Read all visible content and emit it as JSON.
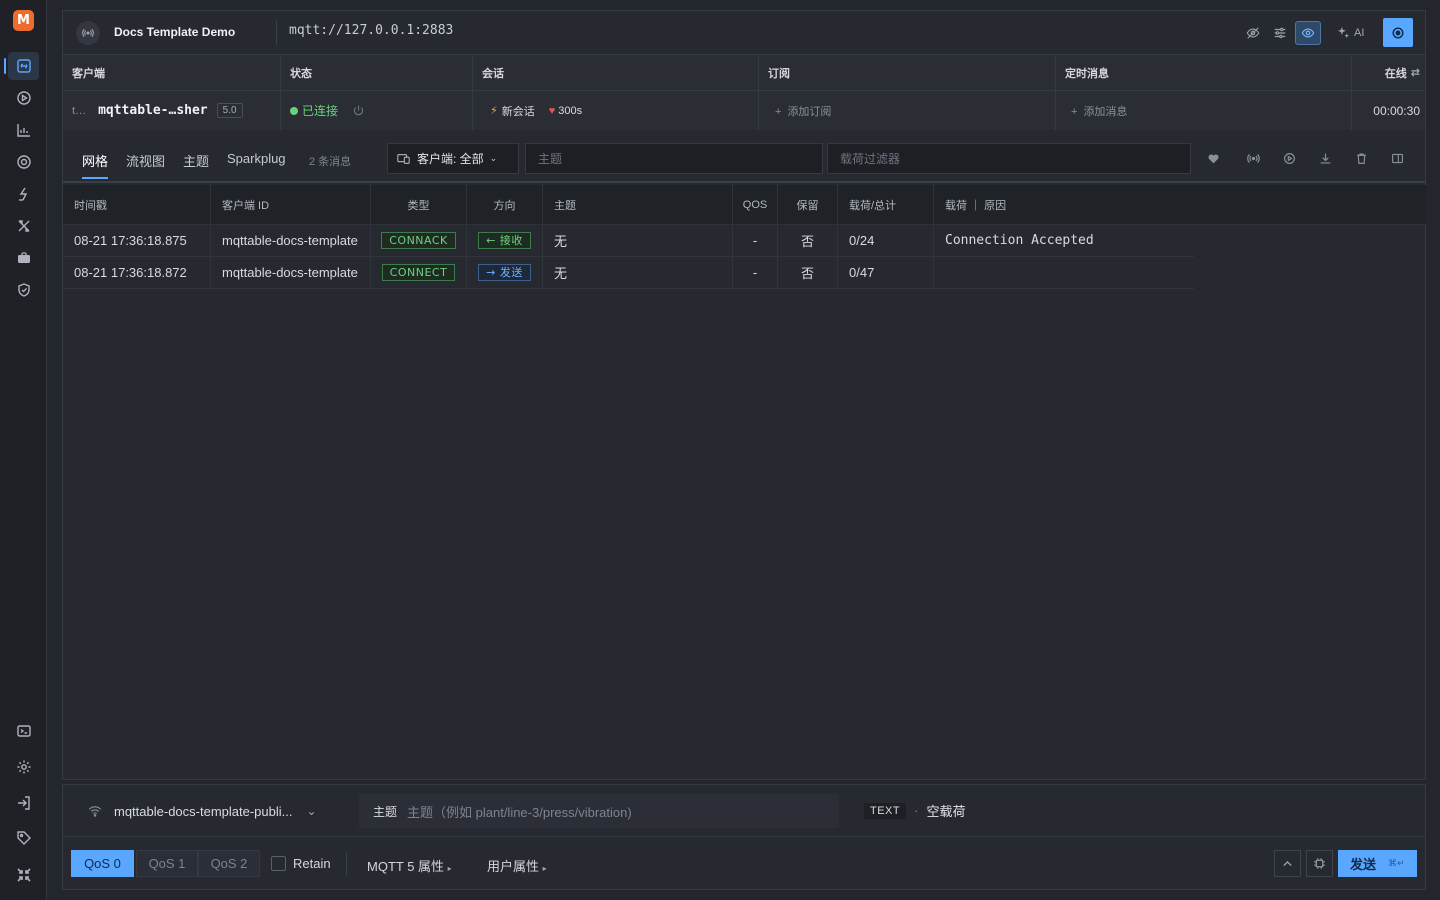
{
  "app": {
    "connection_name": "Docs Template Demo",
    "broker_url": "mqtt://127.0.0.1:2883",
    "ai_label": "AI"
  },
  "client_table": {
    "headers": [
      "客户端",
      "状态",
      "会话",
      "订阅",
      "定时消息",
      "在线"
    ],
    "row": {
      "client_prefix": "t…",
      "client_name": "mqttable-…sher",
      "version": "5.0",
      "status": "已连接",
      "session": "新会话",
      "keepalive": "300s",
      "add_subscription": "添加订阅",
      "add_message": "添加消息",
      "online_time": "00:00:30"
    }
  },
  "filterbar": {
    "tabs": [
      "网格",
      "流视图",
      "主题",
      "Sparkplug"
    ],
    "active_tab": "网格",
    "message_count": "2 条消息",
    "client_filter": "客户端: 全部",
    "topic_placeholder": "主题",
    "payload_placeholder": "载荷过滤器"
  },
  "grid": {
    "headers": [
      "时间戳",
      "客户端 ID",
      "类型",
      "方向",
      "主题",
      "QOS",
      "保留",
      "载荷/总计",
      "载荷 ｜ 原因"
    ],
    "rows": [
      {
        "timestamp": "08-21 17:36:18.875",
        "client_id": "mqttable-docs-template",
        "type": "CONNACK",
        "direction": "← 接收",
        "topic": "无",
        "qos": "-",
        "retain": "否",
        "size": "0/24",
        "payload": "Connection Accepted"
      },
      {
        "timestamp": "08-21 17:36:18.872",
        "client_id": "mqttable-docs-template",
        "type": "CONNECT",
        "direction": "→ 发送",
        "topic": "无",
        "qos": "-",
        "retain": "否",
        "size": "0/47",
        "payload": ""
      }
    ]
  },
  "composer": {
    "client": "mqttable-docs-template-publi...",
    "topic_label": "主题",
    "topic_placeholder": "主题（例如 plant/line-3/press/vibration)",
    "format": "TEXT",
    "separator": "·",
    "payload_status": "空载荷",
    "qos_options": [
      "QoS 0",
      "QoS 1",
      "QoS 2"
    ],
    "qos_selected": "QoS 0",
    "retain_label": "Retain",
    "mqtt5_props": "MQTT 5 属性",
    "user_props": "用户属性",
    "send_label": "发送",
    "send_shortcut": "⌘↵"
  },
  "colors": {
    "accent": "#5aa7ff",
    "connected": "#67d37b",
    "brand": "#ef6c2f"
  }
}
